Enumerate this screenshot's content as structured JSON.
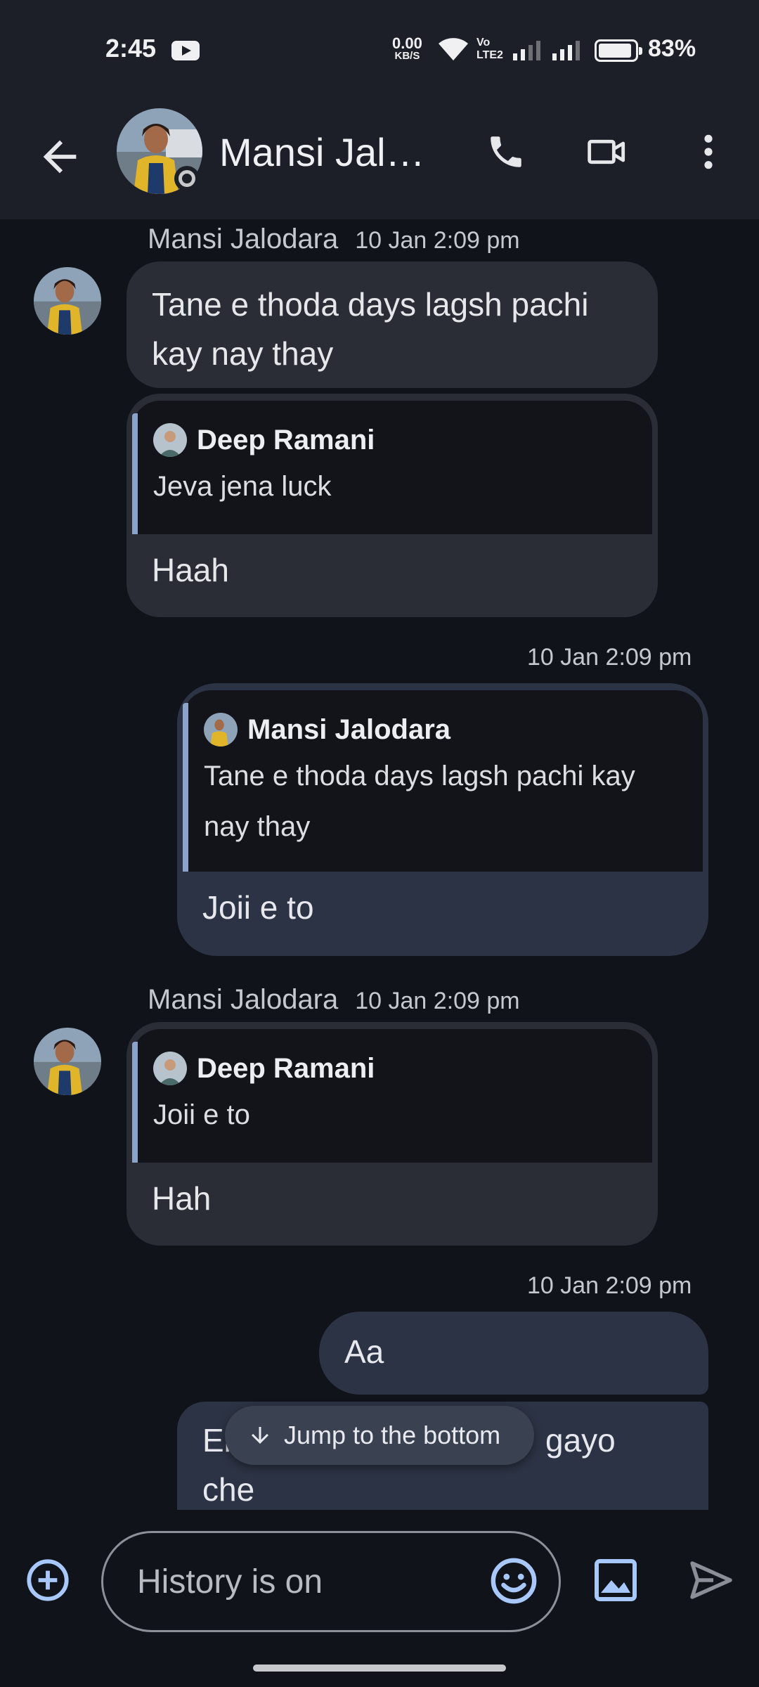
{
  "status_bar": {
    "time": "2:45",
    "speed_value": "0.00",
    "speed_unit": "KB/S",
    "volte": "Vo LTE2",
    "battery": "83%"
  },
  "header": {
    "contact_name": "Mansi Jalodara",
    "actions": [
      "call-icon",
      "video-call-icon",
      "more-vert-icon"
    ]
  },
  "messages": [
    {
      "sender": "Mansi Jalodara",
      "time": "10 Jan 2:09 pm",
      "text": "Tane e thoda days lagsh pachi kay nay thay"
    },
    {
      "quote_author": "Deep Ramani",
      "quote_text": "Jeva jena luck",
      "text": "Haah"
    },
    {
      "time": "10 Jan 2:09 pm",
      "quote_author": "Mansi Jalodara",
      "quote_text": "Tane e thoda days lagsh pachi kay nay thay",
      "text": "Joii e to"
    },
    {
      "sender": "Mansi Jalodara",
      "time": "10 Jan 2:09 pm",
      "quote_author": "Deep Ramani",
      "quote_text": "Joii e to",
      "text": "Hah"
    },
    {
      "time": "10 Jan 2:09 pm",
      "text": "Aa"
    },
    {
      "text_start": "El",
      "text_end": "gayo",
      "text_line2": "che"
    }
  ],
  "jump_button": "Jump to the bottom",
  "composer": {
    "placeholder": "History is on"
  },
  "colors": {
    "background": "#10131a",
    "app_bar": "#1c1f27",
    "incoming_bubble": "#2a2d35",
    "outgoing_bubble": "#2c3344",
    "accent": "#a8c7fa"
  }
}
